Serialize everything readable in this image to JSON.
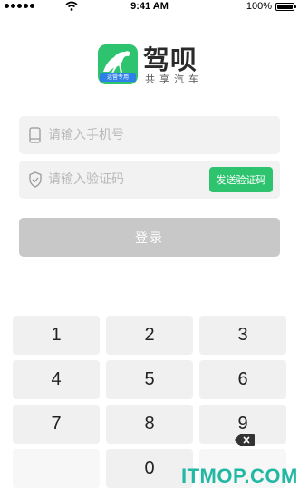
{
  "status_bar": {
    "time": "9:41 AM",
    "battery": "100%"
  },
  "brand": {
    "name": "驾呗",
    "tagline": "共享汽车",
    "badge": "运营专用",
    "color": "#2ec46f"
  },
  "form": {
    "phone_placeholder": "请输入手机号",
    "code_placeholder": "请输入验证码",
    "send_code_label": "发送验证码",
    "login_label": "登录"
  },
  "keypad": {
    "keys": [
      "1",
      "2",
      "3",
      "4",
      "5",
      "6",
      "7",
      "8",
      "9",
      "",
      "0"
    ],
    "delete_icon": "backspace-icon"
  },
  "watermark": "ITMOP.COM",
  "colors": {
    "accent": "#2ec46f",
    "disabled": "#c8c8c8",
    "field_bg": "#f2f2f2"
  }
}
